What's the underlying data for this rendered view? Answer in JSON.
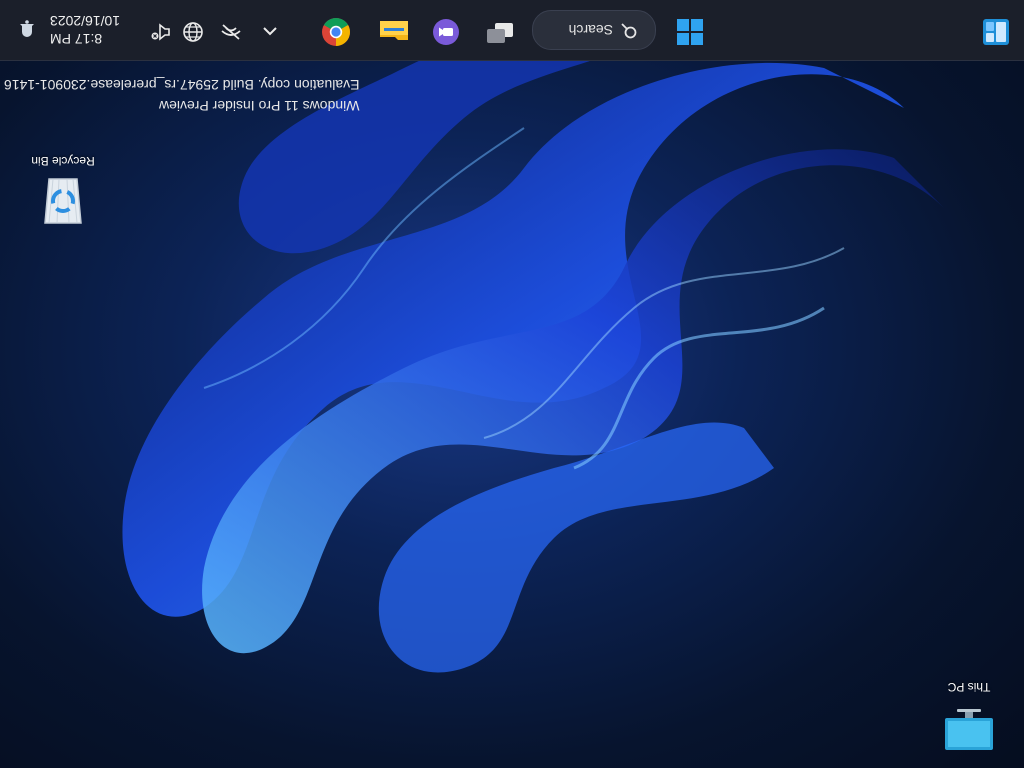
{
  "desktop": {
    "icons": [
      {
        "label": "This PC",
        "icon": "this-pc-icon"
      },
      {
        "label": "Recycle Bin",
        "icon": "recycle-bin-icon"
      }
    ],
    "watermark": {
      "line1": "Windows 11 Pro Insider Preview",
      "line2": "Evaluation copy. Build 25947.rs_prerelease.230901-1416"
    }
  },
  "taskbar": {
    "search_label": "Search",
    "apps": [
      "widgets-icon",
      "start-icon",
      "task-view-icon",
      "meet-icon",
      "file-explorer-icon",
      "chrome-icon"
    ],
    "tray": [
      "chevron-up-icon",
      "network-off-icon",
      "globe-icon",
      "speaker-muted-icon"
    ],
    "time": "8:17 PM",
    "date": "10/16/2023",
    "notification_icon": "notification-icon"
  },
  "colors": {
    "taskbar_bg": "#1b1f2a",
    "wallpaper_accent": "#1f5bff",
    "start_blue": "#2fa3f0"
  }
}
